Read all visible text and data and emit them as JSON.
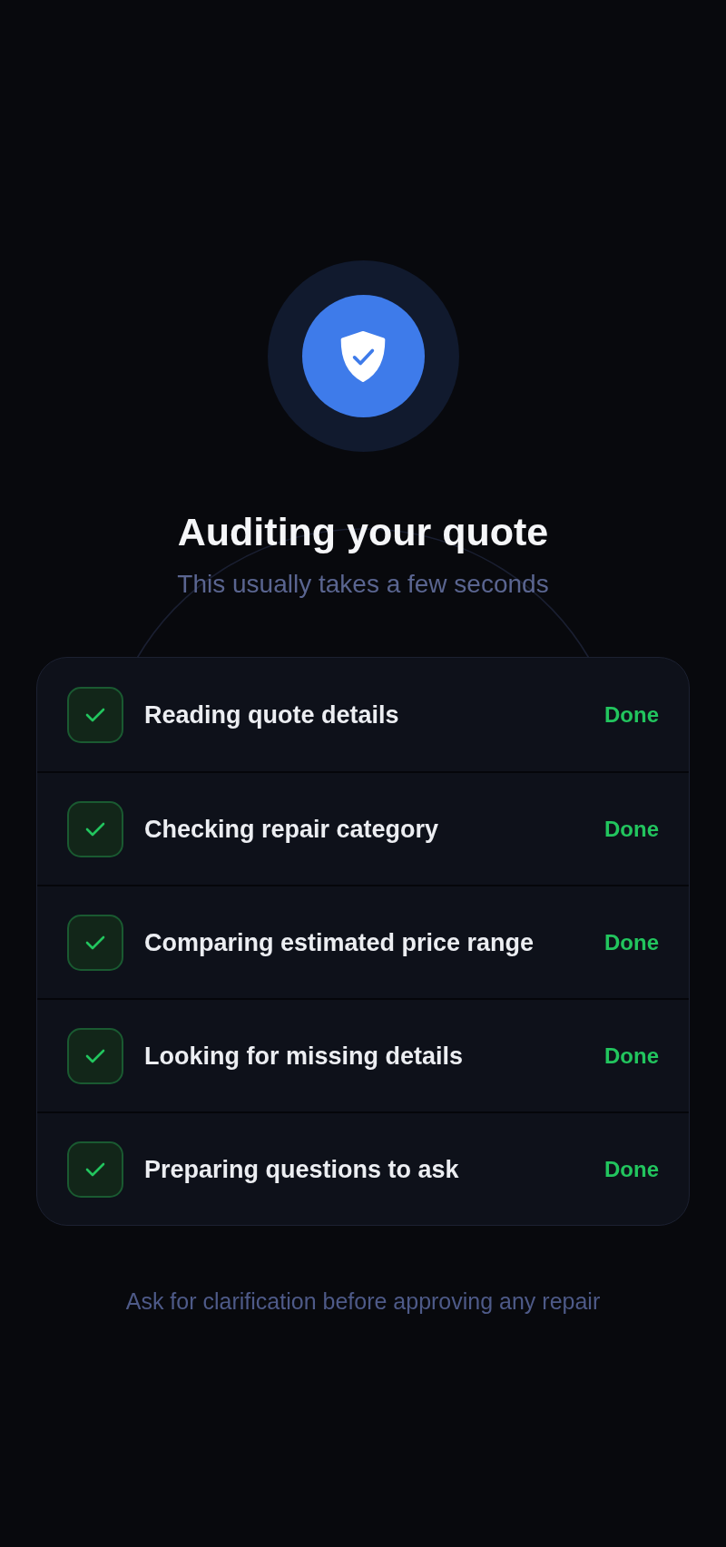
{
  "header": {
    "title": "Auditing your quote",
    "subtitle": "This usually takes a few seconds"
  },
  "steps": [
    {
      "label": "Reading quote details",
      "status": "Done",
      "checked": true
    },
    {
      "label": "Checking repair category",
      "status": "Done",
      "checked": true
    },
    {
      "label": "Comparing estimated price range",
      "status": "Done",
      "checked": true
    },
    {
      "label": "Looking for missing details",
      "status": "Done",
      "checked": true
    },
    {
      "label": "Preparing questions to ask",
      "status": "Done",
      "checked": true
    }
  ],
  "footer": {
    "note": "Ask for clarification before approving any repair"
  }
}
